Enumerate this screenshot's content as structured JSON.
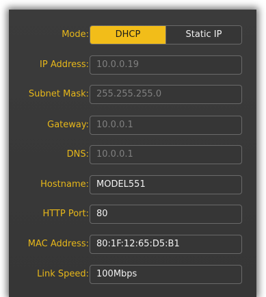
{
  "network": {
    "mode": {
      "label": "Mode:",
      "options": [
        "DHCP",
        "Static IP"
      ],
      "selected": "DHCP",
      "accent_color": "#f2bd19"
    },
    "fields": [
      {
        "label": "IP Address:",
        "value": "10.0.0.19",
        "enabled": false
      },
      {
        "label": "Subnet Mask:",
        "value": "255.255.255.0",
        "enabled": false
      },
      {
        "label": "Gateway:",
        "value": "10.0.0.1",
        "enabled": false
      },
      {
        "label": "DNS:",
        "value": "10.0.0.1",
        "enabled": false
      },
      {
        "label": "Hostname:",
        "value": "MODEL551",
        "enabled": true
      },
      {
        "label": "HTTP Port:",
        "value": "80",
        "enabled": true
      },
      {
        "label": "MAC Address:",
        "value": "80:1F:12:65:D5:B1",
        "enabled": true
      },
      {
        "label": "Link Speed:",
        "value": "100Mbps",
        "enabled": true
      }
    ],
    "label_color": "#e8b81a",
    "panel_color": "#383838"
  }
}
